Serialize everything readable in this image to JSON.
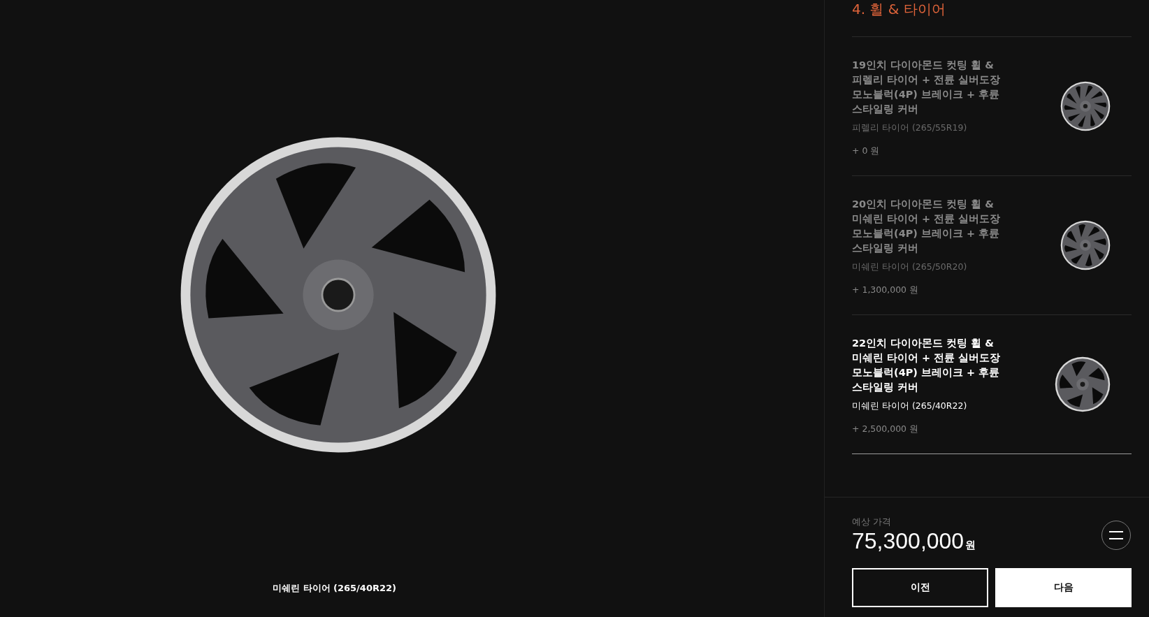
{
  "preview": {
    "caption": "미쉐린 타이어 (265/40R22)"
  },
  "section": {
    "title": "4. 휠 & 타이어"
  },
  "options": [
    {
      "name": "19인치 다이아몬드 컷팅 휠 & 피렐리 타이어 + 전륜 실버도장 모노블럭(4P) 브레이크 + 후륜 스타일링 커버",
      "tire": "피렐리 타이어 (265/55R19)",
      "price": "+ 0 원",
      "selected": false
    },
    {
      "name": "20인치 다이아몬드 컷팅 휠 & 미쉐린 타이어 + 전륜 실버도장 모노블럭(4P) 브레이크 + 후륜 스타일링 커버",
      "tire": "미쉐린 타이어 (265/50R20)",
      "price": "+ 1,300,000 원",
      "selected": false
    },
    {
      "name": "22인치 다이아몬드 컷팅 휠 & 미쉐린 타이어 + 전륜 실버도장 모노블럭(4P) 브레이크 + 후륜 스타일링 커버",
      "tire": "미쉐린 타이어 (265/40R22)",
      "price": "+ 2,500,000 원",
      "selected": true
    }
  ],
  "summary": {
    "label": "예상 가격",
    "amount": "75,300,000",
    "unit": "원"
  },
  "buttons": [
    {
      "label": "이전",
      "kind": "outline"
    },
    {
      "label": "다음",
      "kind": "solid"
    }
  ]
}
